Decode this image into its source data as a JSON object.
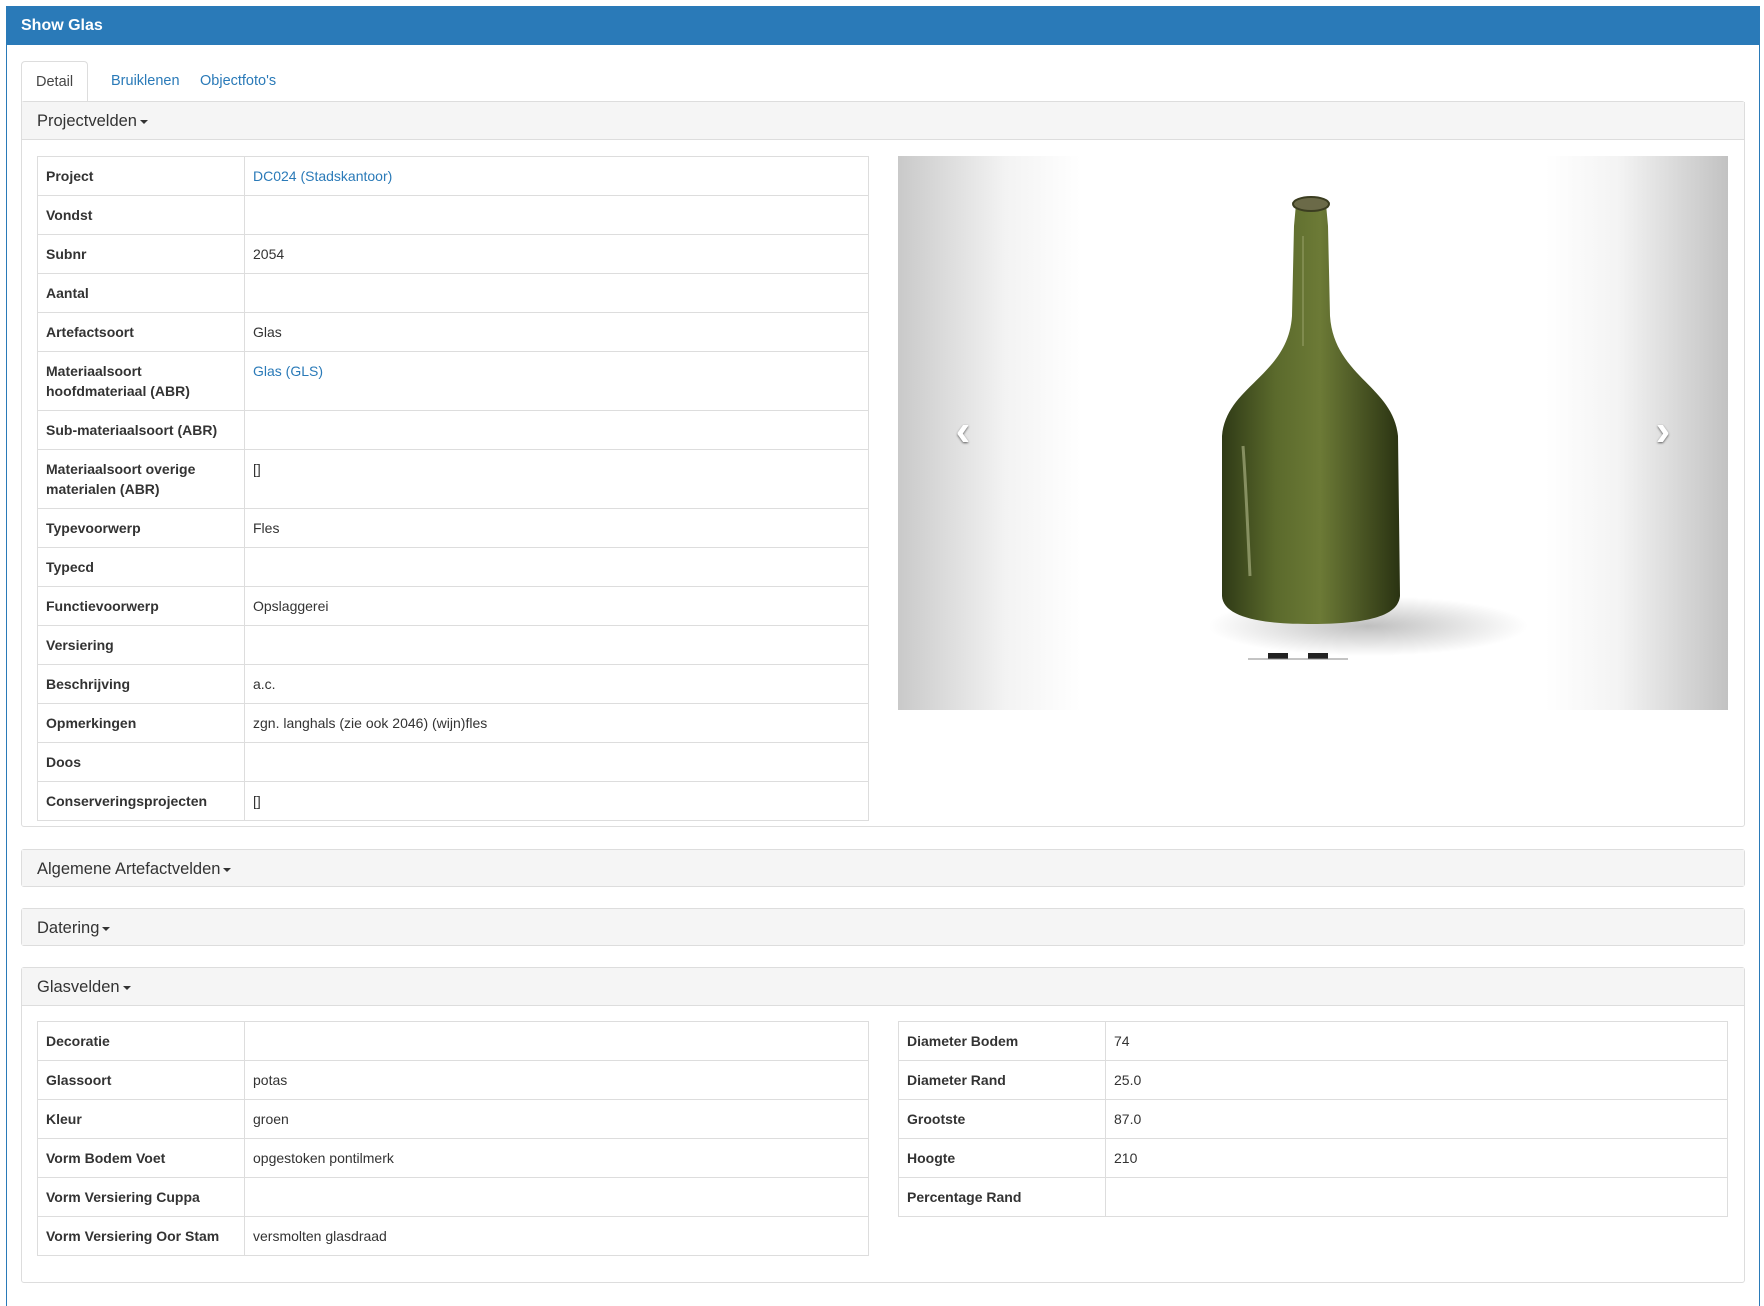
{
  "header": {
    "title": "Show Glas"
  },
  "tabs": [
    {
      "label": "Detail",
      "active": true
    },
    {
      "label": "Bruiklenen",
      "active": false
    },
    {
      "label": "Objectfoto's",
      "active": false
    }
  ],
  "sections": {
    "projectvelden": "Projectvelden",
    "algemene": "Algemene Artefactvelden",
    "datering": "Datering",
    "glasvelden": "Glasvelden"
  },
  "project_fields": [
    {
      "label": "Project",
      "value": "DC024 (Stadskantoor)",
      "link": true
    },
    {
      "label": "Vondst",
      "value": ""
    },
    {
      "label": "Subnr",
      "value": "2054"
    },
    {
      "label": "Aantal",
      "value": ""
    },
    {
      "label": "Artefactsoort",
      "value": "Glas"
    },
    {
      "label": "Materiaalsoort hoofdmateriaal (ABR)",
      "value": "Glas (GLS)",
      "link": true
    },
    {
      "label": "Sub-materiaalsoort (ABR)",
      "value": ""
    },
    {
      "label": "Materiaalsoort overige materialen (ABR)",
      "value": "[]"
    },
    {
      "label": "Typevoorwerp",
      "value": "Fles"
    },
    {
      "label": "Typecd",
      "value": ""
    },
    {
      "label": "Functievoorwerp",
      "value": "Opslaggerei"
    },
    {
      "label": "Versiering",
      "value": ""
    },
    {
      "label": "Beschrijving",
      "value": "a.c."
    },
    {
      "label": "Opmerkingen",
      "value": "zgn. langhals (zie ook 2046) (wijn)fles"
    },
    {
      "label": "Doos",
      "value": ""
    },
    {
      "label": "Conserveringsprojecten",
      "value": "[]"
    }
  ],
  "glas_left": [
    {
      "label": "Decoratie",
      "value": ""
    },
    {
      "label": "Glassoort",
      "value": "potas"
    },
    {
      "label": "Kleur",
      "value": "groen"
    },
    {
      "label": "Vorm Bodem Voet",
      "value": "opgestoken pontilmerk"
    },
    {
      "label": "Vorm Versiering Cuppa",
      "value": ""
    },
    {
      "label": "Vorm Versiering Oor Stam",
      "value": "versmolten glasdraad"
    }
  ],
  "glas_right": [
    {
      "label": "Diameter Bodem",
      "value": "74"
    },
    {
      "label": "Diameter Rand",
      "value": "25.0"
    },
    {
      "label": "Grootste",
      "value": "87.0"
    },
    {
      "label": "Hoogte",
      "value": "210"
    },
    {
      "label": "Percentage Rand",
      "value": ""
    }
  ],
  "carousel": {
    "prev_icon": "chevron-left-icon",
    "next_icon": "chevron-right-icon"
  },
  "colors": {
    "primary": "#2a7ab8",
    "panel_bg": "#f5f5f5",
    "border": "#dddddd",
    "bottle_green": "#4a5a26"
  }
}
